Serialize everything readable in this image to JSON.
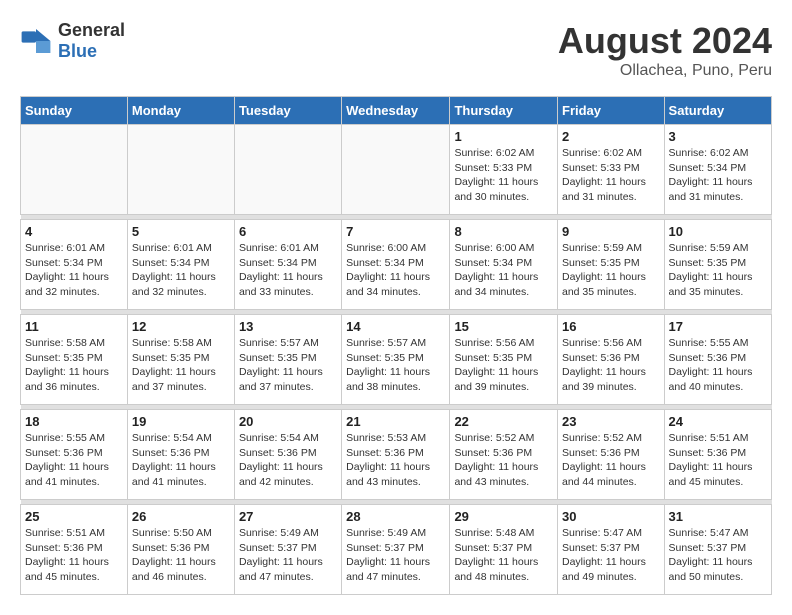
{
  "header": {
    "logo_general": "General",
    "logo_blue": "Blue",
    "month_year": "August 2024",
    "location": "Ollachea, Puno, Peru"
  },
  "weekdays": [
    "Sunday",
    "Monday",
    "Tuesday",
    "Wednesday",
    "Thursday",
    "Friday",
    "Saturday"
  ],
  "weeks": [
    [
      {
        "day": "",
        "info": ""
      },
      {
        "day": "",
        "info": ""
      },
      {
        "day": "",
        "info": ""
      },
      {
        "day": "",
        "info": ""
      },
      {
        "day": "1",
        "info": "Sunrise: 6:02 AM\nSunset: 5:33 PM\nDaylight: 11 hours and 30 minutes."
      },
      {
        "day": "2",
        "info": "Sunrise: 6:02 AM\nSunset: 5:33 PM\nDaylight: 11 hours and 31 minutes."
      },
      {
        "day": "3",
        "info": "Sunrise: 6:02 AM\nSunset: 5:34 PM\nDaylight: 11 hours and 31 minutes."
      }
    ],
    [
      {
        "day": "4",
        "info": "Sunrise: 6:01 AM\nSunset: 5:34 PM\nDaylight: 11 hours and 32 minutes."
      },
      {
        "day": "5",
        "info": "Sunrise: 6:01 AM\nSunset: 5:34 PM\nDaylight: 11 hours and 32 minutes."
      },
      {
        "day": "6",
        "info": "Sunrise: 6:01 AM\nSunset: 5:34 PM\nDaylight: 11 hours and 33 minutes."
      },
      {
        "day": "7",
        "info": "Sunrise: 6:00 AM\nSunset: 5:34 PM\nDaylight: 11 hours and 34 minutes."
      },
      {
        "day": "8",
        "info": "Sunrise: 6:00 AM\nSunset: 5:34 PM\nDaylight: 11 hours and 34 minutes."
      },
      {
        "day": "9",
        "info": "Sunrise: 5:59 AM\nSunset: 5:35 PM\nDaylight: 11 hours and 35 minutes."
      },
      {
        "day": "10",
        "info": "Sunrise: 5:59 AM\nSunset: 5:35 PM\nDaylight: 11 hours and 35 minutes."
      }
    ],
    [
      {
        "day": "11",
        "info": "Sunrise: 5:58 AM\nSunset: 5:35 PM\nDaylight: 11 hours and 36 minutes."
      },
      {
        "day": "12",
        "info": "Sunrise: 5:58 AM\nSunset: 5:35 PM\nDaylight: 11 hours and 37 minutes."
      },
      {
        "day": "13",
        "info": "Sunrise: 5:57 AM\nSunset: 5:35 PM\nDaylight: 11 hours and 37 minutes."
      },
      {
        "day": "14",
        "info": "Sunrise: 5:57 AM\nSunset: 5:35 PM\nDaylight: 11 hours and 38 minutes."
      },
      {
        "day": "15",
        "info": "Sunrise: 5:56 AM\nSunset: 5:35 PM\nDaylight: 11 hours and 39 minutes."
      },
      {
        "day": "16",
        "info": "Sunrise: 5:56 AM\nSunset: 5:36 PM\nDaylight: 11 hours and 39 minutes."
      },
      {
        "day": "17",
        "info": "Sunrise: 5:55 AM\nSunset: 5:36 PM\nDaylight: 11 hours and 40 minutes."
      }
    ],
    [
      {
        "day": "18",
        "info": "Sunrise: 5:55 AM\nSunset: 5:36 PM\nDaylight: 11 hours and 41 minutes."
      },
      {
        "day": "19",
        "info": "Sunrise: 5:54 AM\nSunset: 5:36 PM\nDaylight: 11 hours and 41 minutes."
      },
      {
        "day": "20",
        "info": "Sunrise: 5:54 AM\nSunset: 5:36 PM\nDaylight: 11 hours and 42 minutes."
      },
      {
        "day": "21",
        "info": "Sunrise: 5:53 AM\nSunset: 5:36 PM\nDaylight: 11 hours and 43 minutes."
      },
      {
        "day": "22",
        "info": "Sunrise: 5:52 AM\nSunset: 5:36 PM\nDaylight: 11 hours and 43 minutes."
      },
      {
        "day": "23",
        "info": "Sunrise: 5:52 AM\nSunset: 5:36 PM\nDaylight: 11 hours and 44 minutes."
      },
      {
        "day": "24",
        "info": "Sunrise: 5:51 AM\nSunset: 5:36 PM\nDaylight: 11 hours and 45 minutes."
      }
    ],
    [
      {
        "day": "25",
        "info": "Sunrise: 5:51 AM\nSunset: 5:36 PM\nDaylight: 11 hours and 45 minutes."
      },
      {
        "day": "26",
        "info": "Sunrise: 5:50 AM\nSunset: 5:36 PM\nDaylight: 11 hours and 46 minutes."
      },
      {
        "day": "27",
        "info": "Sunrise: 5:49 AM\nSunset: 5:37 PM\nDaylight: 11 hours and 47 minutes."
      },
      {
        "day": "28",
        "info": "Sunrise: 5:49 AM\nSunset: 5:37 PM\nDaylight: 11 hours and 47 minutes."
      },
      {
        "day": "29",
        "info": "Sunrise: 5:48 AM\nSunset: 5:37 PM\nDaylight: 11 hours and 48 minutes."
      },
      {
        "day": "30",
        "info": "Sunrise: 5:47 AM\nSunset: 5:37 PM\nDaylight: 11 hours and 49 minutes."
      },
      {
        "day": "31",
        "info": "Sunrise: 5:47 AM\nSunset: 5:37 PM\nDaylight: 11 hours and 50 minutes."
      }
    ]
  ]
}
